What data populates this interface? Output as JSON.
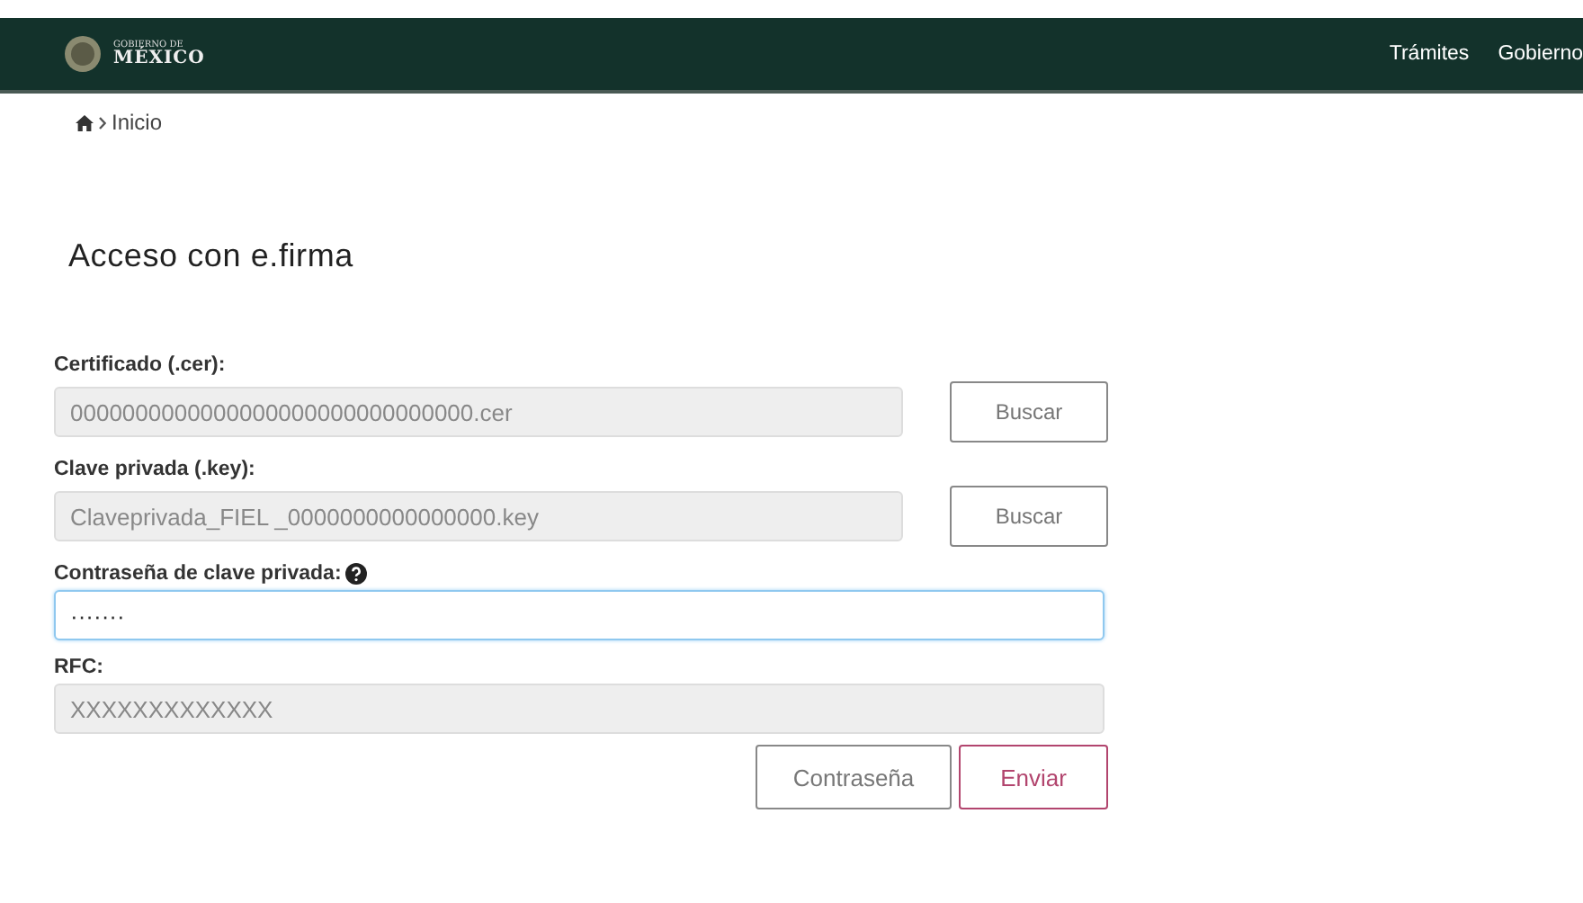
{
  "header": {
    "logo_small": "GOBIERNO DE",
    "logo_big": "MÉXICO",
    "nav": [
      "Trámites",
      "Gobierno"
    ]
  },
  "breadcrumb": {
    "label": "Inicio"
  },
  "title": "Acceso con e.firma",
  "fields": [
    {
      "kind": "file",
      "label": "Certificado (.cer):",
      "value": "0000000000000000000000000000000.cer",
      "disabled": true,
      "focused": false,
      "button": "Buscar"
    },
    {
      "kind": "file",
      "label": "Clave privada (.key):",
      "value": "Claveprivada_FIEL _0000000000000000.key",
      "disabled": true,
      "focused": false,
      "button": "Buscar"
    },
    {
      "kind": "password",
      "label": "Contraseña de clave privada:",
      "help": true,
      "value": "·······",
      "disabled": false,
      "focused": true
    },
    {
      "kind": "text",
      "label": "RFC:",
      "value": "XXXXXXXXXXXXX",
      "disabled": true,
      "focused": false
    }
  ],
  "actions": [
    {
      "label": "Contraseña",
      "primary": false
    },
    {
      "label": "Enviar",
      "primary": true
    }
  ]
}
